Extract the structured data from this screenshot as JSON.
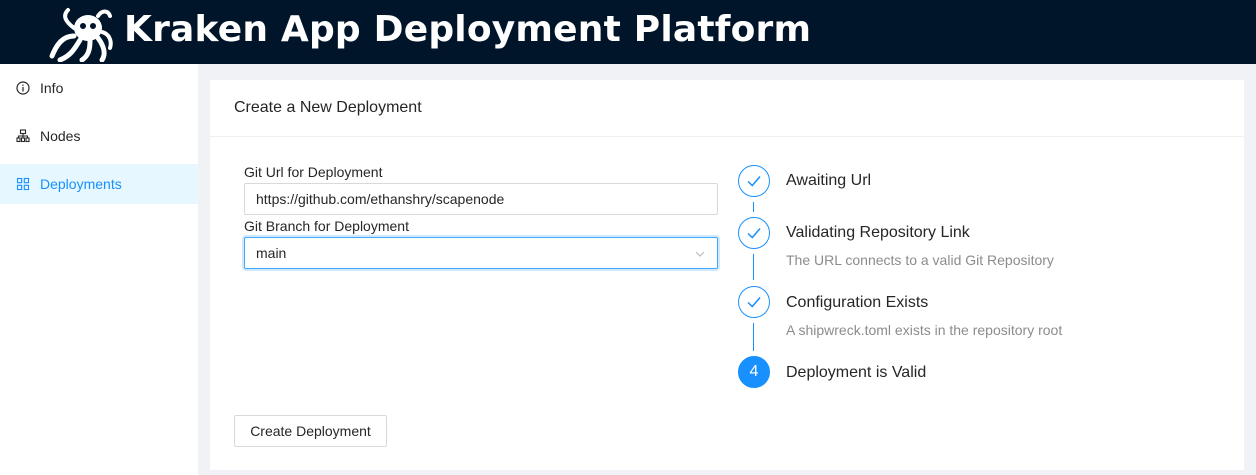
{
  "header": {
    "title": "Kraken App Deployment Platform",
    "logo_icon": "kraken-logo-icon"
  },
  "sidebar": {
    "items": [
      {
        "label": "Info",
        "icon": "info-circle-icon",
        "active": false
      },
      {
        "label": "Nodes",
        "icon": "cluster-icon",
        "active": false
      },
      {
        "label": "Deployments",
        "icon": "appstore-icon",
        "active": true
      }
    ]
  },
  "card": {
    "title": "Create a New Deployment",
    "form": {
      "git_url_label": "Git Url for Deployment",
      "git_url_value": "https://github.com/ethanshry/scapenode",
      "git_branch_label": "Git Branch for Deployment",
      "git_branch_value": "main"
    },
    "create_button": "Create Deployment",
    "steps": [
      {
        "number": "1",
        "title": "Awaiting Url",
        "description": "",
        "status": "finish"
      },
      {
        "number": "2",
        "title": "Validating Repository Link",
        "description": "The URL connects to a valid Git Repository",
        "status": "finish"
      },
      {
        "number": "3",
        "title": "Configuration Exists",
        "description": "A shipwreck.toml exists in the repository root",
        "status": "finish"
      },
      {
        "number": "4",
        "title": "Deployment is Valid",
        "description": "",
        "status": "process"
      }
    ]
  },
  "colors": {
    "header_bg": "#001529",
    "primary": "#1890ff",
    "active_bg": "#e6f7ff",
    "page_bg": "#f0f2f5"
  }
}
